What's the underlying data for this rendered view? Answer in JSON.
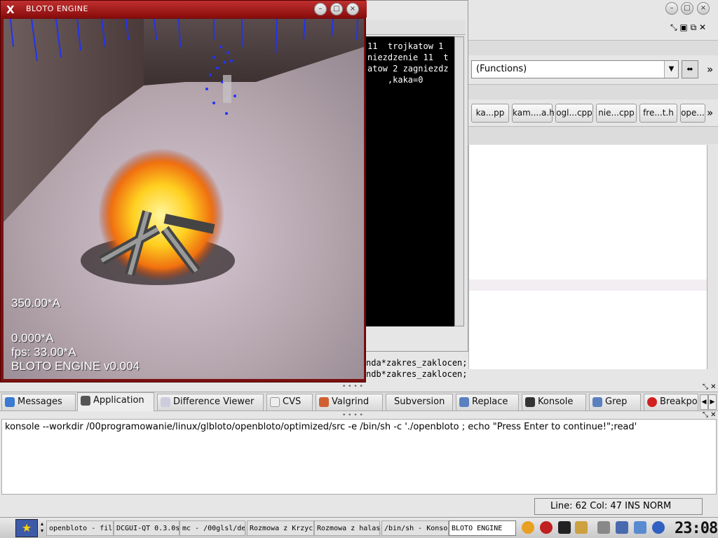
{
  "game_window": {
    "title": "BLOTO ENGINE",
    "hud": {
      "angle1": "350.00*A",
      "angle2": "0.000*A",
      "fps": "fps:  33.00*A",
      "engine": "BLOTO ENGINE v0.004"
    }
  },
  "terminal": {
    "lines": [
      "11  trojkatow 1",
      "niezdzenie 11  t",
      "atow 2 zagniezdz",
      "    ,kaka=0"
    ]
  },
  "code_lines": [
    "nda*zakres_zaklocen;",
    "ndb*zakres_zaklocen;"
  ],
  "functions_combo": "(Functions)",
  "file_tabs": [
    "ka...pp",
    "kam....a.h",
    "ogl...cpp",
    "nie...cpp",
    "fre...t.h",
    "ope..."
  ],
  "more_label": "»",
  "bottom_tabs": [
    {
      "label": "Messages",
      "icon": "messages-icon"
    },
    {
      "label": "Application",
      "icon": "application-icon"
    },
    {
      "label": "Difference Viewer",
      "icon": "diff-icon"
    },
    {
      "label": "CVS",
      "icon": "cvs-icon"
    },
    {
      "label": "Valgrind",
      "icon": "valgrind-icon"
    },
    {
      "label": "Subversion",
      "icon": ""
    },
    {
      "label": "Replace",
      "icon": "replace-icon"
    },
    {
      "label": "Konsole",
      "icon": "konsole-icon"
    },
    {
      "label": "Grep",
      "icon": "grep-icon"
    },
    {
      "label": "Breakpo",
      "icon": "breakpoint-icon"
    }
  ],
  "output_text": "konsole --workdir /00programowanie/linux/glbloto/openbloto/optimized/src -e /bin/sh -c './openbloto ; echo \"Press Enter to continue!\";read'",
  "status_bar": "Line: 62 Col: 47  INS  NORM",
  "taskbar": {
    "tasks": [
      "openbloto - fil",
      "DCGUI-QT 0.3.0s",
      "mc - /00glsl/de",
      "Rozmowa z Krzyc",
      "Rozmowa z halas",
      "/bin/sh - Konso",
      "BLOTO ENGINE"
    ],
    "clock": "23:08"
  },
  "colors": {
    "title_red": "#a01818",
    "terminal_bg": "#000000",
    "highlight_row": "#f2eef2"
  }
}
